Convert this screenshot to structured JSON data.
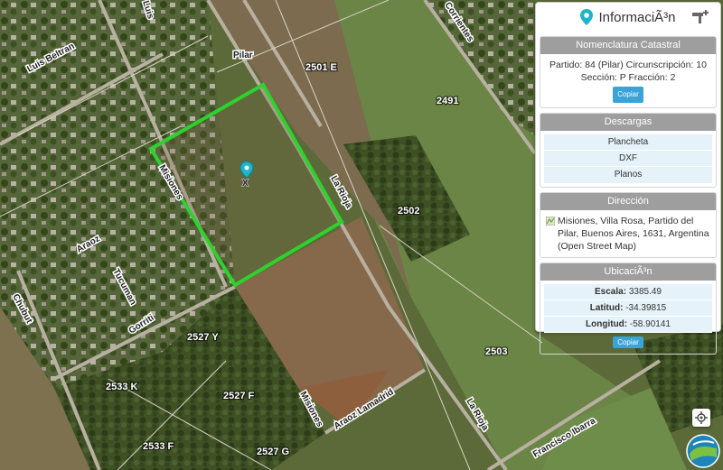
{
  "map": {
    "parcel_labels": [
      "2501 E",
      "2491",
      "2502",
      "2503",
      "2527 Y",
      "2533 K",
      "2527 F",
      "2533 F",
      "2527 G"
    ],
    "streets": [
      "Luis",
      "Luis Beltran",
      "Misiones",
      "Araoz",
      "Tucuman",
      "Chubut",
      "Gorriti",
      "La Rioja",
      "Corrientes",
      "Araoz Lamadrid",
      "Francisco Ibarra",
      "Misiones",
      "La Rioja"
    ],
    "locality": "Pilar",
    "marker_letter": "X",
    "selection_color": "#2fd12f"
  },
  "panel": {
    "title": "InformaciÃ³n",
    "sections": {
      "nomenclatura": {
        "title": "Nomenclatura Catastral",
        "line1": "Partido: 84 (Pilar) Circunscripción: 10",
        "line2": "Sección: P Fracción: 2",
        "copy_label": "Copiar"
      },
      "descargas": {
        "title": "Descargas",
        "items": [
          "Plancheta",
          "DXF",
          "Planos"
        ]
      },
      "direccion": {
        "title": "Dirección",
        "text": "Misiones, Villa Rosa, Partido del Pilar, Buenos Aires, 1631, Argentina (Open Street Map)"
      },
      "ubicacion": {
        "title": "UbicaciÃ³n",
        "escala_label": "Escala:",
        "escala_value": "3385.49",
        "latitud_label": "Latitud:",
        "latitud_value": "-34.39815",
        "longitud_label": "Longitud:",
        "longitud_value": "-58.90141",
        "copy_label": "Copiar"
      }
    }
  },
  "colors": {
    "accent": "#3aa3d7",
    "section_header": "#9e9e9e",
    "row_bg": "#e5f2f9",
    "pin": "#1fb5c9"
  },
  "icons": {
    "title": "map-pin-icon",
    "tool": "ruler-tool-icon",
    "address": "osm-icon",
    "locate": "crosshair-icon",
    "logo": "app-logo"
  }
}
